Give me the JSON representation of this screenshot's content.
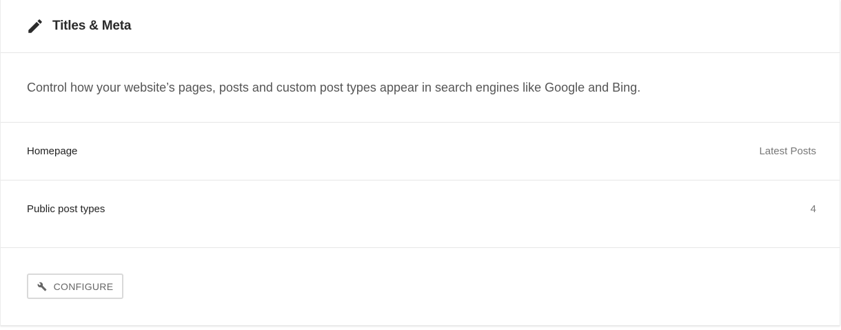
{
  "header": {
    "icon": "pencil-icon",
    "title": "Titles & Meta"
  },
  "description": "Control how your website’s pages, posts and custom post types appear in search engines like Google and Bing.",
  "rows": [
    {
      "label": "Homepage",
      "value": "Latest Posts"
    },
    {
      "label": "Public post types",
      "value": "4"
    }
  ],
  "footer": {
    "button_icon": "wrench-icon",
    "button_label": "CONFIGURE"
  },
  "colors": {
    "text": "#2b2b2b",
    "muted": "#777777",
    "border": "#e6e6e6"
  }
}
